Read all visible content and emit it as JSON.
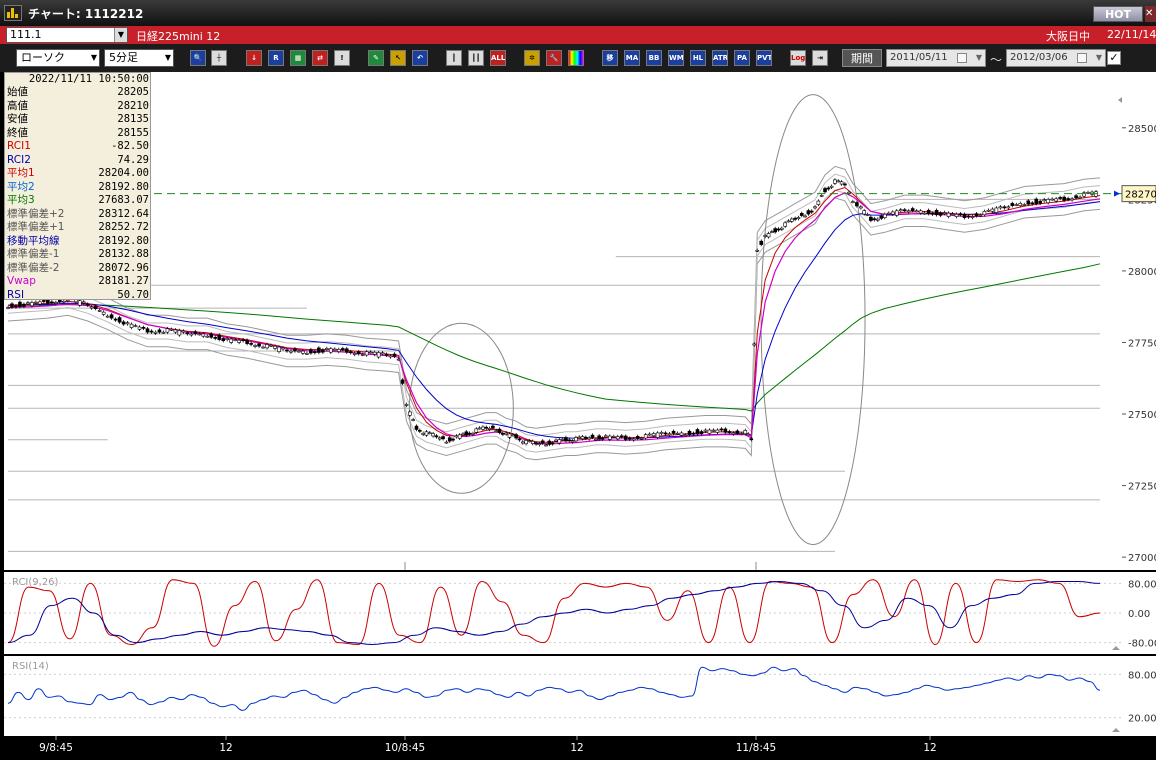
{
  "window": {
    "title": "チャート: 1112212",
    "hot_label": "HOT",
    "close_glyph": "✕"
  },
  "infobar": {
    "code": "111.1",
    "name": "日経225mini 12",
    "market": "大阪日中",
    "datetime": "22/11/14"
  },
  "toolbar": {
    "chart_type": "ローソク",
    "interval": "5分足",
    "buttons": [
      "zoom",
      "draw",
      "download",
      "report",
      "table",
      "compare",
      "alert",
      "pen",
      "cursor",
      "undo",
      "bar1",
      "bar2",
      "ALL",
      "tool",
      "wrench",
      "palette",
      "移動",
      "MA",
      "BB",
      "WMA",
      "HL",
      "ATR",
      "PA",
      "PVT",
      "Log",
      "export"
    ],
    "all_label": "ALL",
    "ma_label": "MA",
    "bb_label": "BB",
    "wma_label": "WMA",
    "hl_label": "HL",
    "atr_label": "ATR",
    "pvt_label": "PVT",
    "log_label": "Log",
    "period_label": "期間",
    "date_from": "2011/05/11",
    "date_to": "2012/03/06",
    "tilde": "～",
    "check": "✓"
  },
  "panel": {
    "datetime": "2022/11/11  10:50:00",
    "rows": [
      {
        "label": "始値",
        "value": "28205",
        "color": "#000000"
      },
      {
        "label": "高値",
        "value": "28210",
        "color": "#000000"
      },
      {
        "label": "安値",
        "value": "28135",
        "color": "#000000"
      },
      {
        "label": "終値",
        "value": "28155",
        "color": "#000000"
      },
      {
        "label": "RCI1",
        "value": "-82.50",
        "color": "#cc0000"
      },
      {
        "label": "RCI2",
        "value": "74.29",
        "color": "#0000aa"
      },
      {
        "label": "平均1",
        "value": "28204.00",
        "color": "#cc0000"
      },
      {
        "label": "平均2",
        "value": "28192.80",
        "color": "#0066cc"
      },
      {
        "label": "平均3",
        "value": "27683.07",
        "color": "#007700"
      },
      {
        "label": "標準偏差+2",
        "value": "28312.64",
        "color": "#555555"
      },
      {
        "label": "標準偏差+1",
        "value": "28252.72",
        "color": "#555555"
      },
      {
        "label": "移動平均線",
        "value": "28192.80",
        "color": "#0000aa"
      },
      {
        "label": "標準偏差-1",
        "value": "28132.88",
        "color": "#555555"
      },
      {
        "label": "標準偏差-2",
        "value": "28072.96",
        "color": "#555555"
      },
      {
        "label": "Vwap",
        "value": "28181.27",
        "color": "#cc00cc"
      },
      {
        "label": "RSI",
        "value": "50.70",
        "color": "#0000aa"
      }
    ]
  },
  "chart_data": [
    {
      "type": "candlestick",
      "price_axis_ticks": [
        28500,
        28250,
        28000,
        27750,
        27500,
        27250,
        27000
      ],
      "price_axis_tick_labels": [
        "28500",
        "28250",
        "28000",
        "27750",
        "27500",
        "27250",
        "27000"
      ],
      "ylim": [
        26990,
        28660
      ],
      "current_price": 28270,
      "current_price_label": "28270",
      "x_tick_labels": [
        "9/8:45",
        "12",
        "10/8:45",
        "12",
        "11/8:45",
        "12"
      ],
      "series": [
        {
          "name": "平均1",
          "color": "#cc0000"
        },
        {
          "name": "平均2",
          "color": "#0000cc"
        },
        {
          "name": "平均3",
          "color": "#007700"
        },
        {
          "name": "Vwap",
          "color": "#cc00cc"
        },
        {
          "name": "標準偏差",
          "color": "#888888"
        }
      ],
      "close_path": [
        [
          0,
          27880
        ],
        [
          20,
          27885
        ],
        [
          40,
          27890
        ],
        [
          60,
          27900
        ],
        [
          80,
          27880
        ],
        [
          100,
          27850
        ],
        [
          120,
          27815
        ],
        [
          140,
          27790
        ],
        [
          160,
          27790
        ],
        [
          180,
          27780
        ],
        [
          200,
          27780
        ],
        [
          220,
          27760
        ],
        [
          240,
          27750
        ],
        [
          260,
          27735
        ],
        [
          280,
          27720
        ],
        [
          300,
          27720
        ],
        [
          320,
          27725
        ],
        [
          340,
          27720
        ],
        [
          360,
          27710
        ],
        [
          380,
          27705
        ],
        [
          392,
          27700
        ],
        [
          400,
          27530
        ],
        [
          410,
          27450
        ],
        [
          420,
          27430
        ],
        [
          430,
          27420
        ],
        [
          440,
          27410
        ],
        [
          450,
          27420
        ],
        [
          460,
          27430
        ],
        [
          470,
          27440
        ],
        [
          480,
          27450
        ],
        [
          490,
          27450
        ],
        [
          500,
          27430
        ],
        [
          510,
          27420
        ],
        [
          520,
          27400
        ],
        [
          530,
          27395
        ],
        [
          540,
          27400
        ],
        [
          550,
          27405
        ],
        [
          560,
          27410
        ],
        [
          570,
          27410
        ],
        [
          580,
          27415
        ],
        [
          590,
          27420
        ],
        [
          600,
          27420
        ],
        [
          620,
          27415
        ],
        [
          640,
          27420
        ],
        [
          660,
          27430
        ],
        [
          680,
          27435
        ],
        [
          700,
          27440
        ],
        [
          720,
          27440
        ],
        [
          740,
          27435
        ],
        [
          746,
          27410
        ],
        [
          752,
          28080
        ],
        [
          760,
          28120
        ],
        [
          770,
          28140
        ],
        [
          780,
          28160
        ],
        [
          790,
          28180
        ],
        [
          800,
          28200
        ],
        [
          810,
          28220
        ],
        [
          820,
          28280
        ],
        [
          830,
          28310
        ],
        [
          840,
          28300
        ],
        [
          848,
          28250
        ],
        [
          856,
          28220
        ],
        [
          866,
          28180
        ],
        [
          880,
          28190
        ],
        [
          900,
          28210
        ],
        [
          920,
          28210
        ],
        [
          940,
          28200
        ],
        [
          960,
          28190
        ],
        [
          980,
          28200
        ],
        [
          1000,
          28220
        ],
        [
          1020,
          28240
        ],
        [
          1040,
          28245
        ],
        [
          1060,
          28250
        ],
        [
          1080,
          28265
        ],
        [
          1096,
          28270
        ]
      ]
    },
    {
      "type": "line",
      "title": "RCI(9,26)",
      "ticks": [
        80,
        0,
        -80
      ],
      "tick_labels": [
        "80.00",
        "0.00",
        "-80.00"
      ],
      "ylim": [
        -100,
        100
      ],
      "series": [
        {
          "name": "RCI1",
          "color": "#cc0000",
          "values": [
            -80,
            70,
            60,
            -70,
            80,
            -60,
            -85,
            -40,
            90,
            80,
            -90,
            20,
            85,
            -75,
            10,
            90,
            -80,
            -85,
            80,
            -60,
            -80,
            70,
            -60,
            85,
            30,
            -60,
            -80,
            40,
            80,
            70,
            80,
            70,
            -20,
            60,
            -80,
            70,
            -80,
            85,
            80,
            70,
            -80,
            50,
            90,
            -10,
            90,
            -85,
            80,
            -80,
            90,
            85,
            90,
            80,
            -10,
            0
          ]
        },
        {
          "name": "RCI2",
          "color": "#000099",
          "values": [
            -80,
            -60,
            20,
            40,
            0,
            -60,
            -80,
            -70,
            -60,
            -50,
            -60,
            -50,
            -40,
            -45,
            -50,
            -60,
            -80,
            -85,
            -80,
            -60,
            -40,
            -50,
            -60,
            -50,
            -30,
            -10,
            0,
            10,
            0,
            10,
            20,
            40,
            50,
            60,
            70,
            80,
            85,
            80,
            60,
            20,
            -40,
            -20,
            40,
            20,
            -40,
            20,
            40,
            50,
            80,
            85,
            85,
            80
          ]
        }
      ]
    },
    {
      "type": "line",
      "title": "RSI(14)",
      "ticks": [
        80,
        20
      ],
      "tick_labels": [
        "80.00",
        "20.00"
      ],
      "ylim": [
        0,
        100
      ],
      "series": [
        {
          "name": "RSI",
          "color": "#0033cc",
          "values": [
            40,
            55,
            45,
            60,
            48,
            50,
            42,
            40,
            38,
            52,
            45,
            48,
            55,
            45,
            38,
            42,
            48,
            45,
            52,
            48,
            40,
            35,
            38,
            30,
            40,
            45,
            50,
            48,
            55,
            58,
            52,
            45,
            40,
            48,
            55,
            60,
            62,
            58,
            55,
            60,
            55,
            48,
            50,
            58,
            60,
            55,
            60,
            58,
            52,
            48,
            55,
            50,
            58,
            62,
            60,
            55,
            58,
            50,
            45,
            50,
            55,
            58,
            62,
            60,
            55,
            52,
            48,
            50,
            90,
            85,
            88,
            85,
            80,
            78,
            82,
            90,
            85,
            88,
            78,
            70,
            65,
            60,
            55,
            62,
            60,
            55,
            50,
            52,
            55,
            60,
            65,
            62,
            58,
            60,
            62,
            65,
            68,
            72,
            75,
            72,
            78,
            75,
            80,
            78,
            72,
            75,
            70,
            58
          ]
        }
      ]
    }
  ]
}
